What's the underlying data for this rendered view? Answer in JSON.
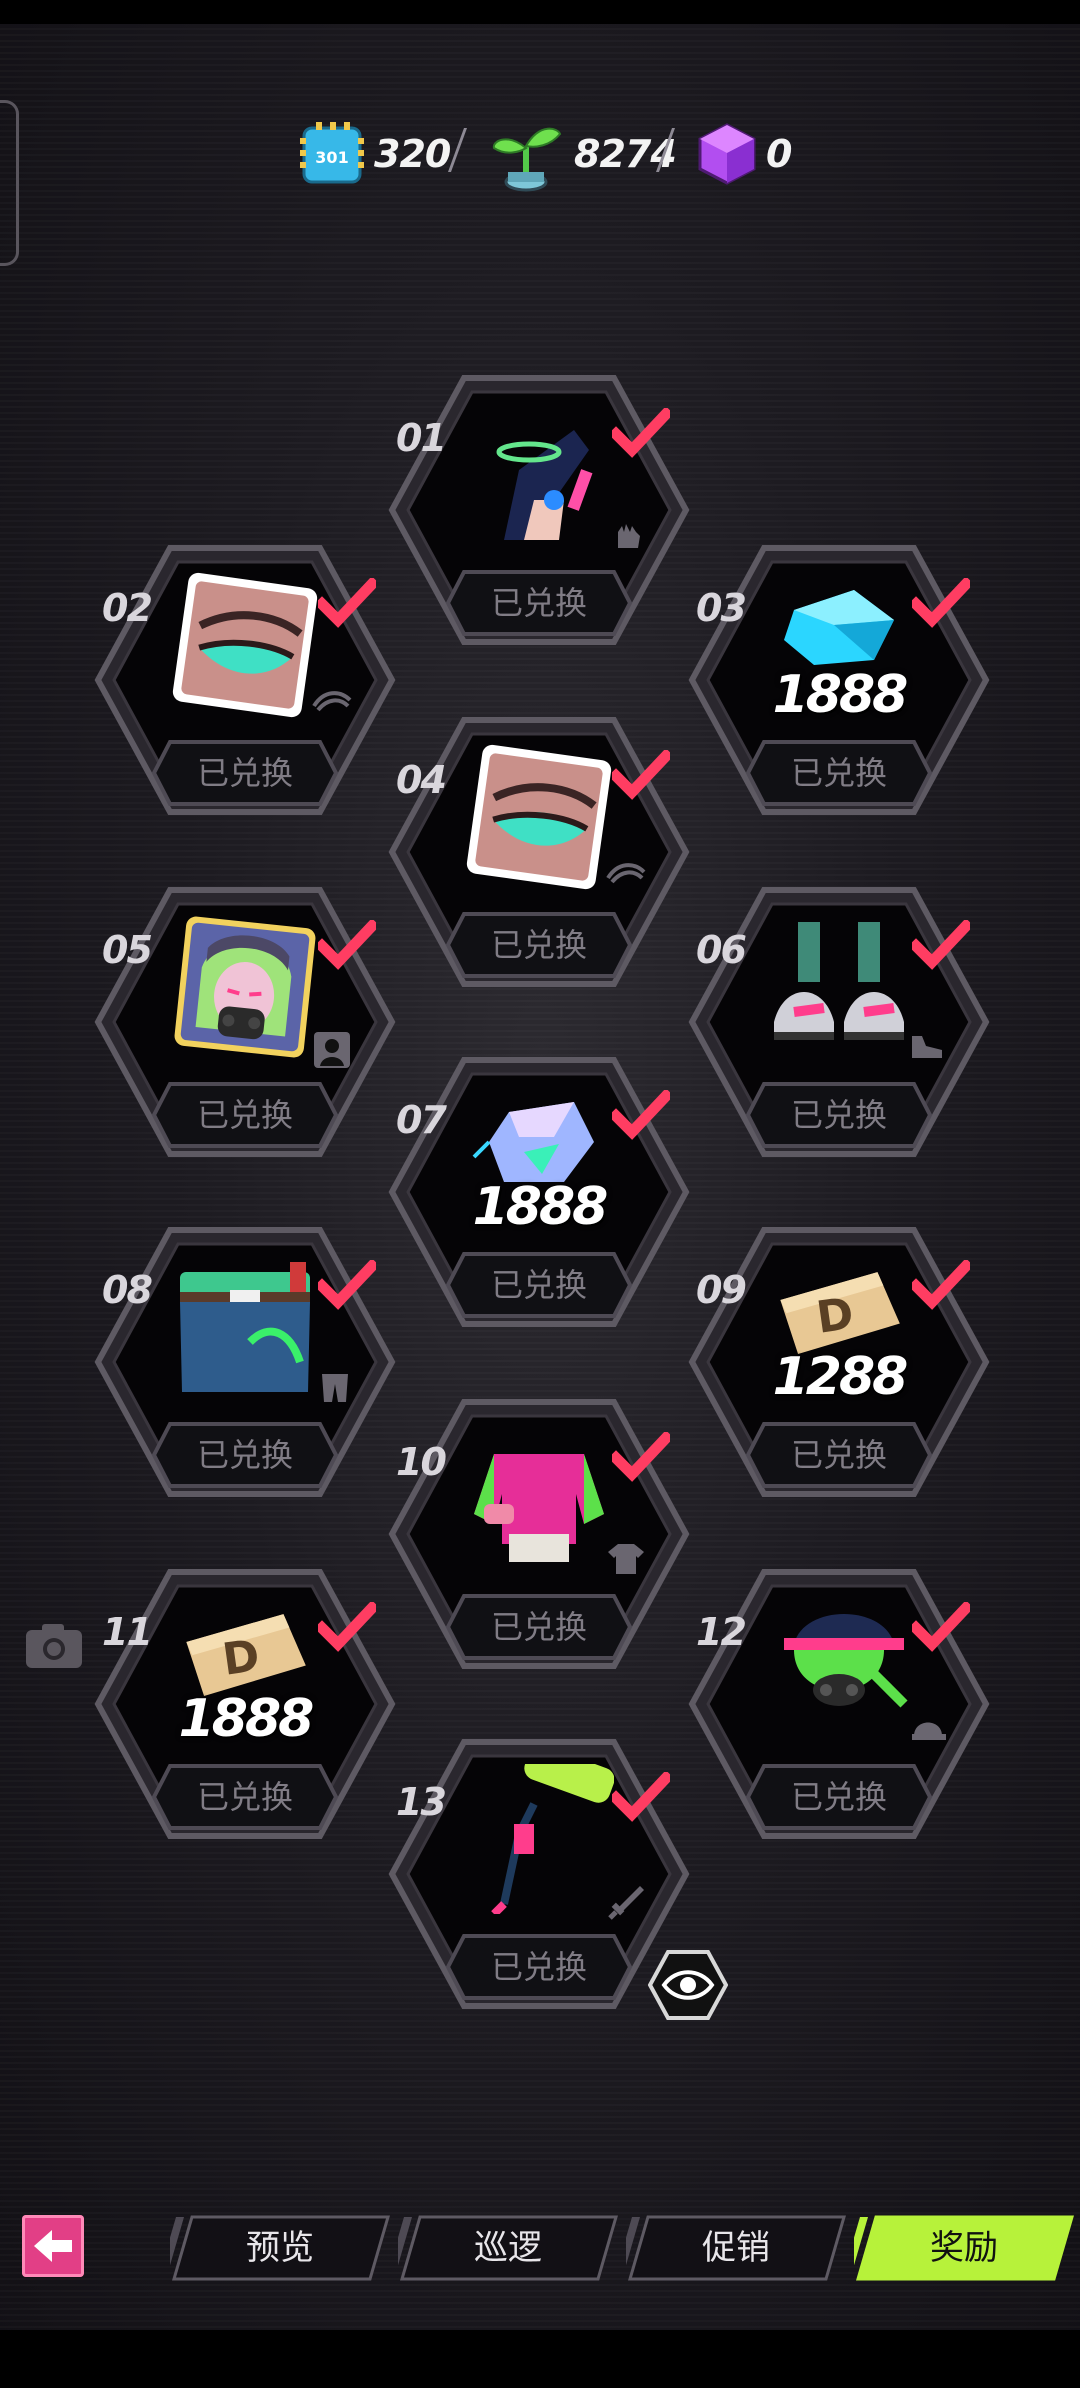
{
  "currencies": [
    {
      "icon": "chip-token-icon",
      "icon_text": "301",
      "value": "320"
    },
    {
      "icon": "sprout-icon",
      "value": "8274"
    },
    {
      "icon": "purple-cube-icon",
      "value": "0"
    }
  ],
  "rewards": [
    {
      "num": "01",
      "item": "fingerless-glove-art",
      "type_icon": "glove-icon",
      "status": "已兑换",
      "checked": true
    },
    {
      "num": "02",
      "item": "eye-makeup-art",
      "type_icon": "eyebrow-icon",
      "status": "已兑换",
      "checked": true
    },
    {
      "num": "03",
      "item": "blue-gem-art",
      "amount": "1888",
      "status": "已兑换",
      "checked": true
    },
    {
      "num": "04",
      "item": "eye-makeup-art",
      "type_icon": "eyebrow-icon",
      "status": "已兑换",
      "checked": true
    },
    {
      "num": "05",
      "item": "avatar-portrait-art",
      "type_icon": "profile-icon",
      "status": "已兑换",
      "checked": true
    },
    {
      "num": "06",
      "item": "sneakers-art",
      "type_icon": "shoe-icon",
      "status": "已兑换",
      "checked": true
    },
    {
      "num": "07",
      "item": "crystal-token-art",
      "amount": "1888",
      "status": "已兑换",
      "checked": true
    },
    {
      "num": "08",
      "item": "pants-art",
      "type_icon": "pants-icon",
      "status": "已兑换",
      "checked": true
    },
    {
      "num": "09",
      "item": "ticket-d-art",
      "amount": "1288",
      "status": "已兑换",
      "checked": true
    },
    {
      "num": "10",
      "item": "jacket-art",
      "type_icon": "shirt-icon",
      "status": "已兑换",
      "checked": true
    },
    {
      "num": "11",
      "item": "ticket-d-art",
      "amount": "1888",
      "status": "已兑换",
      "checked": true
    },
    {
      "num": "12",
      "item": "cap-mask-art",
      "type_icon": "hat-icon",
      "status": "已兑换",
      "checked": true
    },
    {
      "num": "13",
      "item": "paint-roller-art",
      "type_icon": "weapon-icon",
      "status": "已兑换",
      "checked": true
    }
  ],
  "tabs": [
    {
      "label": "预览",
      "active": false
    },
    {
      "label": "巡逻",
      "active": false
    },
    {
      "label": "促销",
      "active": false
    },
    {
      "label": "奖励",
      "active": true
    }
  ],
  "colors": {
    "accent_pink": "#e23f86",
    "check_red": "#ff3d62",
    "active_tab": "#b7f23a",
    "hex_border": "#5e5a63",
    "button_text": "#807c85"
  }
}
